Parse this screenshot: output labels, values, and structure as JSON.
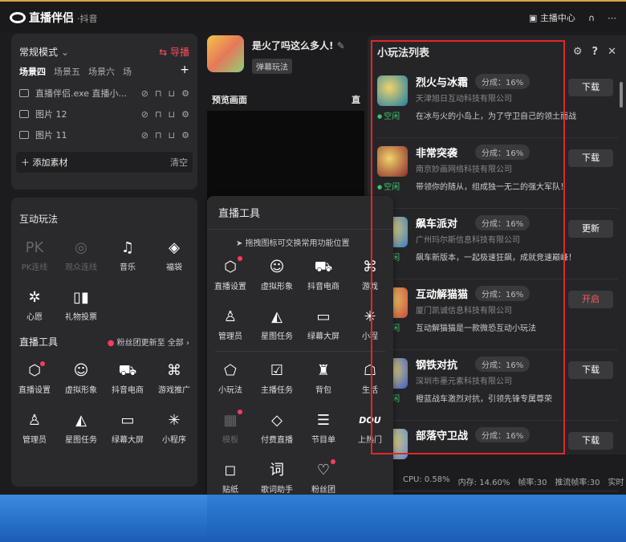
{
  "app": {
    "title": "直播伴侣",
    "subtitle": "·抖音",
    "anchor_center": "主播中心"
  },
  "scene": {
    "mode": "常规模式",
    "guide": "导播",
    "tabs": [
      "场景四",
      "场景五",
      "场景六",
      "场"
    ],
    "sources": [
      {
        "label": "直播伴侣.exe 直播小..."
      },
      {
        "label": "图片 12"
      },
      {
        "label": "图片 11"
      }
    ],
    "add_label": "添加素材",
    "clear_label": "清空"
  },
  "interactive": {
    "title": "互动玩法",
    "items": [
      {
        "label": "PK连线",
        "glyph": "PK",
        "dim": true
      },
      {
        "label": "观众连线",
        "glyph": "◎",
        "dim": true
      },
      {
        "label": "音乐",
        "glyph": "♫"
      },
      {
        "label": "福袋",
        "glyph": "◈"
      },
      {
        "label": "心愿",
        "glyph": "✲"
      },
      {
        "label": "礼物投票",
        "glyph": "▯▮"
      }
    ]
  },
  "live_tools": {
    "title": "直播工具",
    "notice": "粉丝团更新至",
    "all_label": "全部",
    "items": [
      {
        "label": "直播设置",
        "glyph": "⬡",
        "dot": true
      },
      {
        "label": "虚拟形象",
        "glyph": "☺"
      },
      {
        "label": "抖音电商",
        "glyph": "⛟"
      },
      {
        "label": "游戏推广",
        "glyph": "⌘"
      },
      {
        "label": "管理员",
        "glyph": "♙"
      },
      {
        "label": "星图任务",
        "glyph": "◭"
      },
      {
        "label": "绿幕大屏",
        "glyph": "▭"
      },
      {
        "label": "小程序",
        "glyph": "✳"
      }
    ]
  },
  "stream": {
    "title": "是火了吗这么多人!",
    "tag": "弹幕玩法",
    "preview_label": "预览画面",
    "preview_label2": "直"
  },
  "popup": {
    "title": "直播工具",
    "hint": "拖拽图标可交换常用功能位置",
    "row1": [
      {
        "label": "直播设置",
        "glyph": "⬡",
        "dot": true
      },
      {
        "label": "虚拟形象",
        "glyph": "☺"
      },
      {
        "label": "抖音电商",
        "glyph": "⛟"
      },
      {
        "label": "游戏",
        "glyph": "⌘"
      }
    ],
    "row2": [
      {
        "label": "管理员",
        "glyph": "♙"
      },
      {
        "label": "星图任务",
        "glyph": "◭"
      },
      {
        "label": "绿幕大屏",
        "glyph": "▭"
      },
      {
        "label": "小程",
        "glyph": "✳"
      }
    ],
    "row3": [
      {
        "label": "小玩法",
        "glyph": "⬠"
      },
      {
        "label": "主播任务",
        "glyph": "☑"
      },
      {
        "label": "背包",
        "glyph": "♜"
      },
      {
        "label": "生活",
        "glyph": "☖"
      }
    ],
    "row4": [
      {
        "label": "模板",
        "glyph": "▦",
        "dim": true,
        "dot": true
      },
      {
        "label": "付费直播",
        "glyph": "◇"
      },
      {
        "label": "节目单",
        "glyph": "☰"
      },
      {
        "label": "上热门",
        "glyph": "DOU"
      }
    ],
    "row5": [
      {
        "label": "贴纸",
        "glyph": "◻"
      },
      {
        "label": "歌词助手",
        "glyph": "词"
      },
      {
        "label": "粉丝团",
        "glyph": "♡",
        "dot": true
      }
    ]
  },
  "games": {
    "title": "小玩法列表",
    "items": [
      {
        "name": "烈火与冰霜",
        "share": "分成：16%",
        "corp": "天津旭日互动科技有限公司",
        "status": "空闲",
        "desc": "在冰与火的小岛上，为了守卫自己的领土而战",
        "btn": "下载",
        "color": "#1e7fa8"
      },
      {
        "name": "非常突袭",
        "share": "分成：16%",
        "corp": "南京妙画网络科技有限公司",
        "status": "空闲",
        "desc": "带领你的随从，组成独一无二的强大军队！",
        "btn": "下载",
        "color": "#8a2b2b"
      },
      {
        "name": "飙车派对",
        "share": "分成：16%",
        "corp": "广州玛尔斯信息科技有限公司",
        "status": "空闲",
        "desc": "飙车新版本，一起极速狂飙，成就竞速巅峰！",
        "btn": "更新",
        "color": "#3a7bc8"
      },
      {
        "name": "互动解猫猫",
        "share": "分成：16%",
        "corp": "厦门凯诚信息科技有限公司",
        "status": "空闲",
        "desc": "互动解猫猫是一款微恐互动小玩法",
        "btn": "开启",
        "color": "#c64a3b"
      },
      {
        "name": "钢铁对抗",
        "share": "分成：16%",
        "corp": "深圳市墨元素科技有限公司",
        "status": "空闲",
        "desc": "橙蓝战车激烈对抗，引领先锋专属尊荣",
        "btn": "下载",
        "color": "#3b5ec6"
      },
      {
        "name": "部落守卫战",
        "share": "分成：16%",
        "corp": "",
        "status": "",
        "desc": "",
        "btn": "下载",
        "color": "#5a8ad6"
      }
    ]
  },
  "stats": {
    "cpu": "CPU: 0.58%",
    "mem": "内存: 14.60%",
    "fps": "帧率:30",
    "push_fps": "推流帧率:30",
    "more": "实时"
  }
}
